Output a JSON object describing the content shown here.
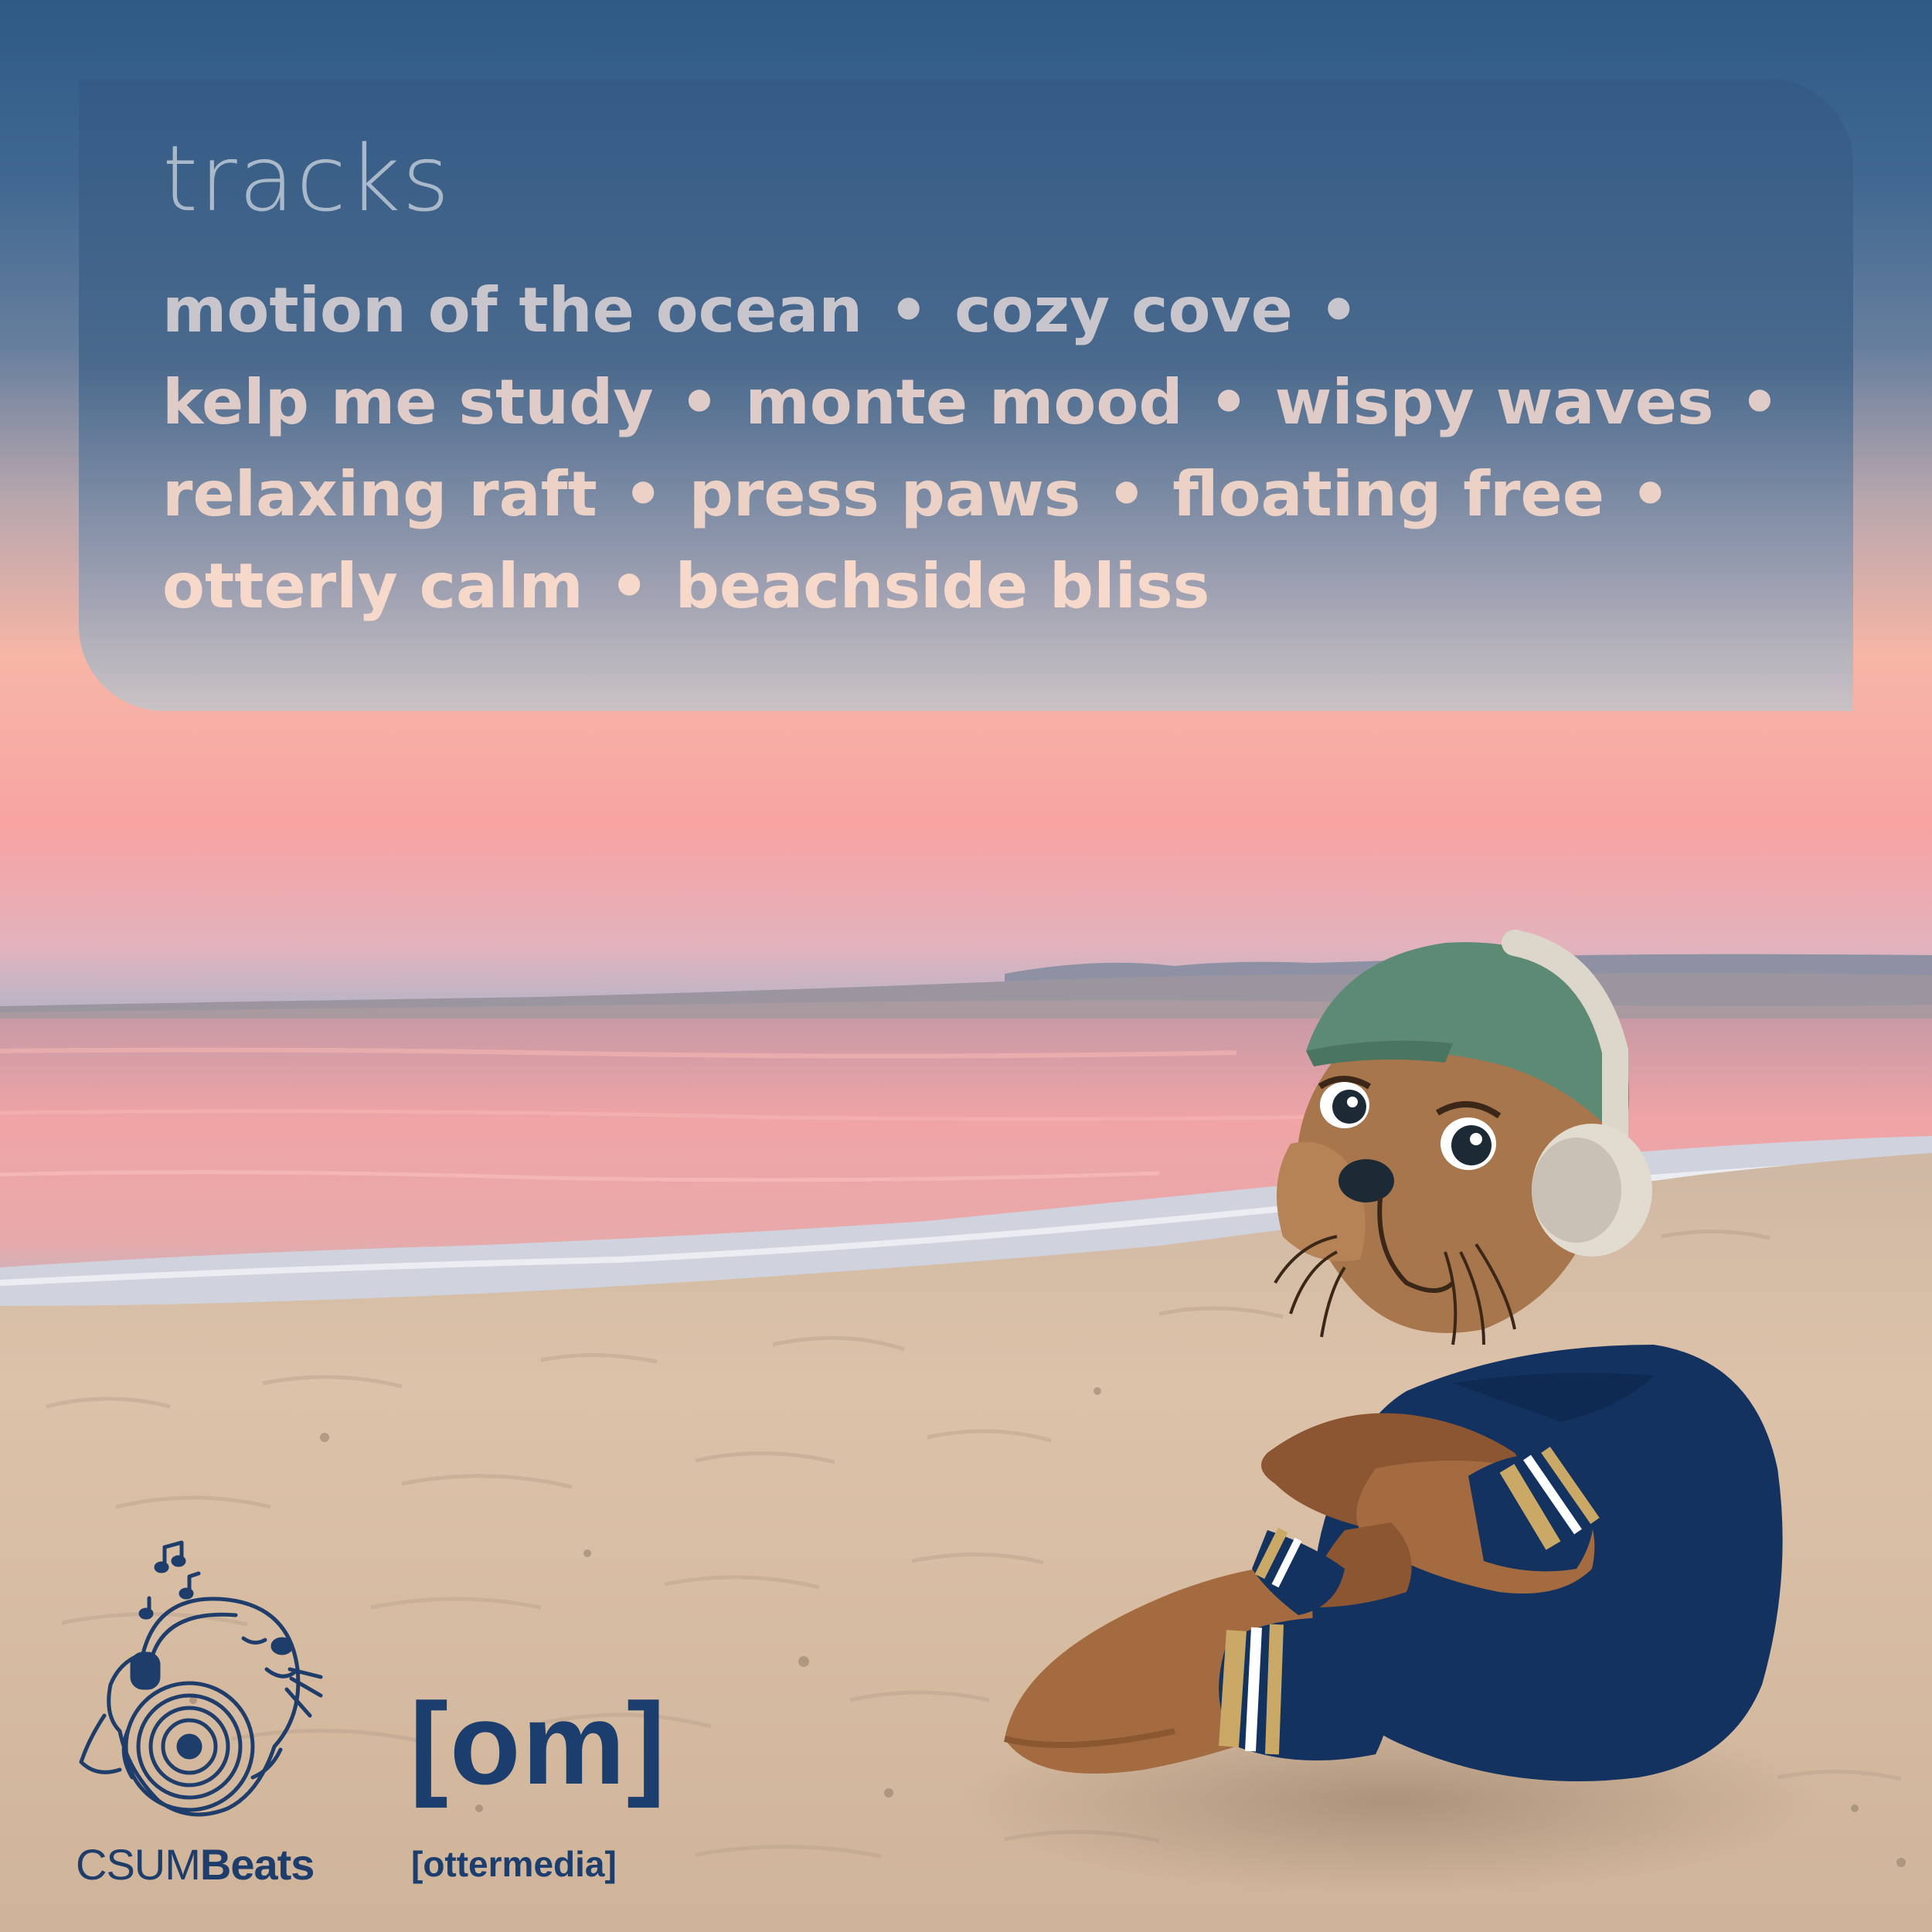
{
  "panel": {
    "heading": "tracks",
    "tracks": [
      "motion of the ocean",
      "cozy cove",
      "kelp me study",
      "monte mood",
      "wispy waves",
      "relaxing raft",
      "press paws",
      "floating free",
      "otterly calm",
      "beachside bliss"
    ],
    "separator": "•"
  },
  "branding": {
    "csum_light": "CSUM",
    "csum_bold": "Beats",
    "om_logo": "[om]",
    "om_caption": "[ottermedia]"
  },
  "colors": {
    "sky_top": "#2f5a86",
    "sunset_pink": "#f7a3a3",
    "ocean": "#f1a6a8",
    "sand": "#d8c1a6",
    "navy": "#1b3e6f",
    "otter_brown": "#a8764c",
    "cap_green": "#5d8a75"
  },
  "icons": {
    "csum_mark": "otter-with-headphones-and-record-icon",
    "otter": "otter-mascot-with-headphones"
  }
}
